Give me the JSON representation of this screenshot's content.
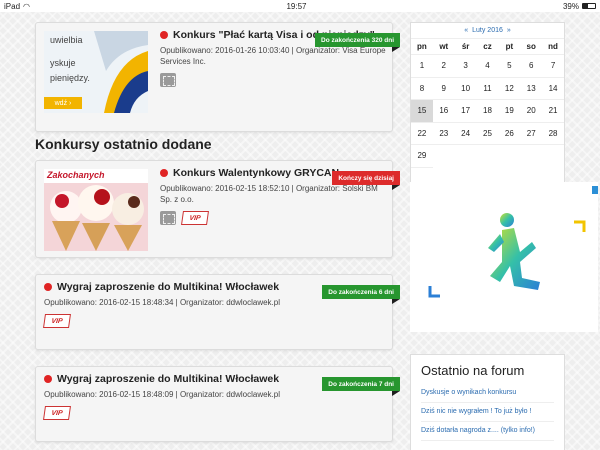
{
  "status": {
    "device": "iPad",
    "time": "19:57",
    "battery": "39%",
    "battery_level": 0.39
  },
  "main": {
    "section_title": "Konkursy ostatnio dodane",
    "featured": {
      "title": "Konkurs \"Płać kartą Visa i od pieniędzy\"",
      "meta": "Opublikowano: 2016-01-26 10:03:40 | Organizator: Visa Europe Services Inc.",
      "ribbon": "Do zakończenia 320 dni",
      "thumb_lines": [
        "uwielbia",
        "yskuje",
        "pieniędzy."
      ],
      "thumb_button": "wdź ›"
    },
    "cards": [
      {
        "title": "Konkurs Walentynkowy GRYCAN",
        "meta": "Opublikowano: 2016-02-15 18:52:10 | Organizator: Solski BM Sp. z o.o.",
        "ribbon": "Kończy się dzisiaj",
        "ribbon_color": "#dd2b2b",
        "thumb_label": "Zakochanych",
        "has_stamp": true
      },
      {
        "title": "Wygraj zaproszenie do Multikina! Włocławek",
        "meta": "Opublikowano: 2016-02-15 18:48:34 | Organizator: ddwloclawek.pl",
        "ribbon": "Do zakończenia 6 dni",
        "ribbon_color": "#27962f"
      },
      {
        "title": "Wygraj zaproszenie do Multikina! Włocławek",
        "meta": "Opublikowano: 2016-02-15 18:48:09 | Organizator: ddwloclawek.pl",
        "ribbon": "Do zakończenia 7 dni",
        "ribbon_color": "#27962f"
      }
    ],
    "vip_label": "VIP"
  },
  "calendar": {
    "prev": "«",
    "month": "Luty 2016",
    "next": "»",
    "weekdays": [
      "pn",
      "wt",
      "śr",
      "cz",
      "pt",
      "so",
      "nd"
    ],
    "days": [
      "1",
      "2",
      "3",
      "4",
      "5",
      "6",
      "7",
      "8",
      "9",
      "10",
      "11",
      "12",
      "13",
      "14",
      "15",
      "16",
      "17",
      "18",
      "19",
      "20",
      "21",
      "22",
      "23",
      "24",
      "25",
      "26",
      "27",
      "28",
      "29"
    ],
    "today": "15"
  },
  "forum": {
    "title": "Ostatnio na forum",
    "links": [
      "Dyskusje o wynikach konkursu",
      "Dziś nic nie wygrałem ! To już było !",
      "Dziś dotarła nagroda z.... (tylko info!)"
    ]
  },
  "colors": {
    "accent": "#2b6cb0",
    "green": "#27962f",
    "red": "#dd2b2b"
  }
}
